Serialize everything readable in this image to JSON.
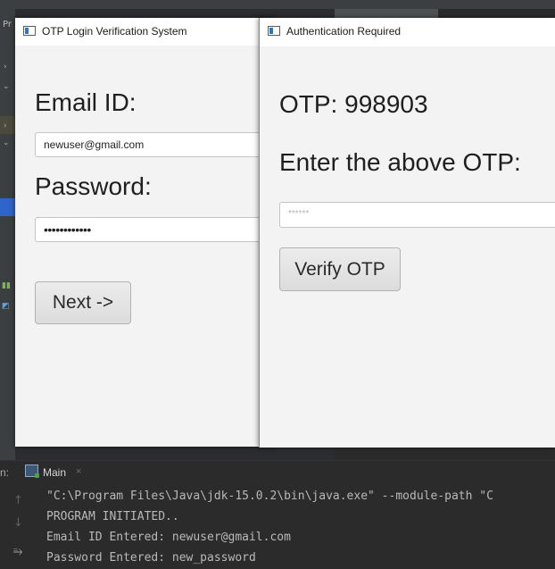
{
  "ide": {
    "left_label": "Pr"
  },
  "login_window": {
    "title": "OTP Login Verification System",
    "email_label": "Email ID:",
    "email_value": "newuser@gmail.com",
    "password_label": "Password:",
    "password_value": "••••••••••••",
    "next_button": "Next ->"
  },
  "otp_window": {
    "title": "Authentication Required",
    "otp_text": "OTP: 998903",
    "prompt": "Enter the above OTP:",
    "otp_placeholder": "******",
    "verify_button": "Verify OTP"
  },
  "run_panel": {
    "prefix": "n:",
    "tab_label": "Main",
    "tab_close": "×",
    "lines": [
      "\"C:\\Program Files\\Java\\jdk-15.0.2\\bin\\java.exe\" --module-path \"C",
      "PROGRAM INITIATED..",
      "Email ID Entered: newuser@gmail.com",
      "Password Entered: new_password"
    ]
  }
}
